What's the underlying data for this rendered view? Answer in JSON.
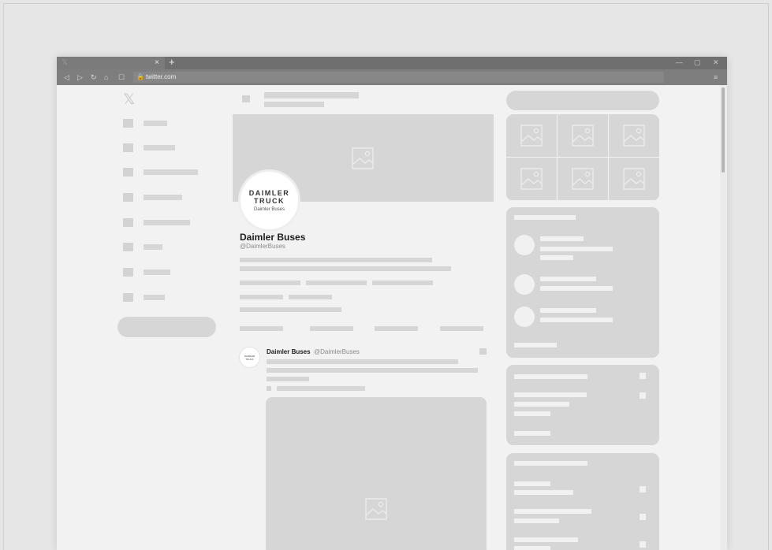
{
  "browser": {
    "tab_favicon": "𝕏",
    "tab_close": "×",
    "new_tab": "+",
    "window_minimize": "—",
    "window_restore": "▢",
    "window_close": "✕",
    "nav": {
      "back": "◁",
      "forward": "▷",
      "reload": "↻",
      "home": "⌂",
      "bookmark": "☐"
    },
    "lock": "🔒",
    "url": "twitter.com",
    "menu": "≡"
  },
  "sidebar": {
    "logo": "𝕏"
  },
  "profile": {
    "avatar_line1": "DAIMLER",
    "avatar_line2": "TRUCK",
    "avatar_line3": "Daimler Buses",
    "name": "Daimler Buses",
    "handle": "@DaimlerBuses"
  },
  "tweet": {
    "avatar_line1": "DAIMLER",
    "avatar_line2": "TRUCK",
    "author": "Daimler Buses",
    "handle": "@DaimlerBuses"
  },
  "colors": {
    "page_bg": "#e6e6e6",
    "browser_bg": "#f2f2f2",
    "placeholder": "#d6d6d6",
    "chrome_dark": "#6f6f6f"
  }
}
